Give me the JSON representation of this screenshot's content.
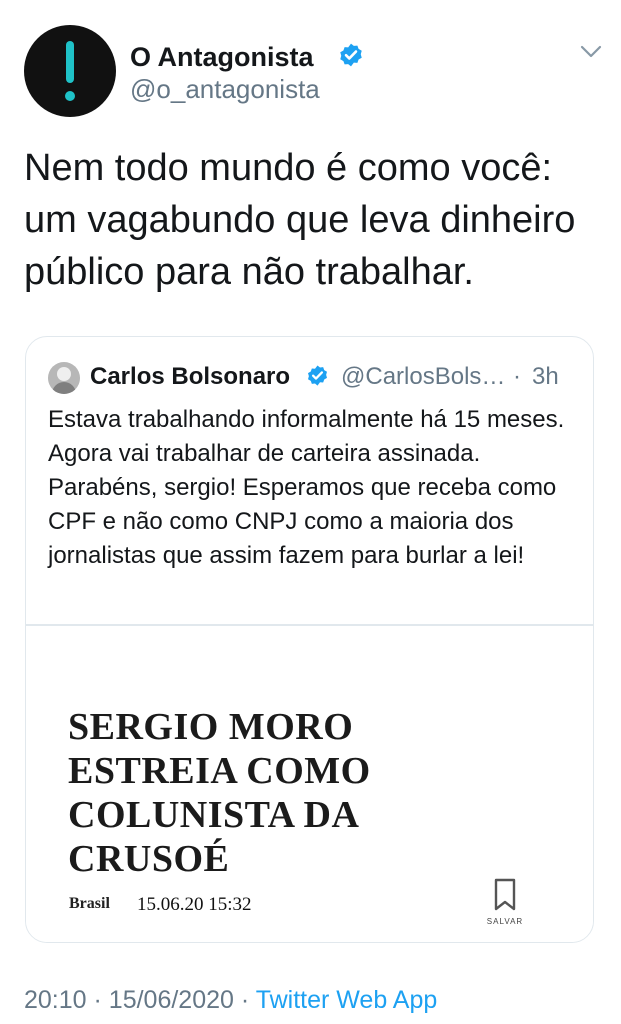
{
  "tweet": {
    "author": {
      "name": "O Antagonista",
      "handle": "@o_antagonista"
    },
    "text": "Nem todo mundo é como você: um vagabundo que leva dinheiro público para não trabalhar.",
    "footer": {
      "time": "20:10",
      "separator": "·",
      "date": "15/06/2020",
      "separator_2": "·",
      "source": "Twitter Web App"
    }
  },
  "quoted_tweet": {
    "author": {
      "name": "Carlos Bolsonaro",
      "handle": "@CarlosBols…"
    },
    "dot": "·",
    "time": "3h",
    "text": "Estava trabalhando informalmente há 15 meses. Agora vai trabalhar de carteira assinada. Parabéns, sergio! Esperamos que receba como CPF e não como CNPJ como a maioria dos jornalistas que assim fazem para burlar a lei!",
    "preview": {
      "headline": "SERGIO MORO ESTREIA COMO COLUNISTA DA CRUSOÉ",
      "section": "Brasil",
      "datetime": "15.06.20 15:32",
      "save_label": "SALVAR"
    }
  },
  "colors": {
    "text": "#14171a",
    "secondary": "#657786",
    "link": "#1da1f2",
    "verified": "#1da1f2",
    "border": "#e1e8ed",
    "avatar_background": "#111111",
    "avatar_accent": "#1fc2c8"
  },
  "icons": {
    "verified": "verified-badge-icon",
    "menu": "chevron-down-icon",
    "bookmark": "bookmark-icon",
    "logo": "exclamation-logo-icon"
  }
}
